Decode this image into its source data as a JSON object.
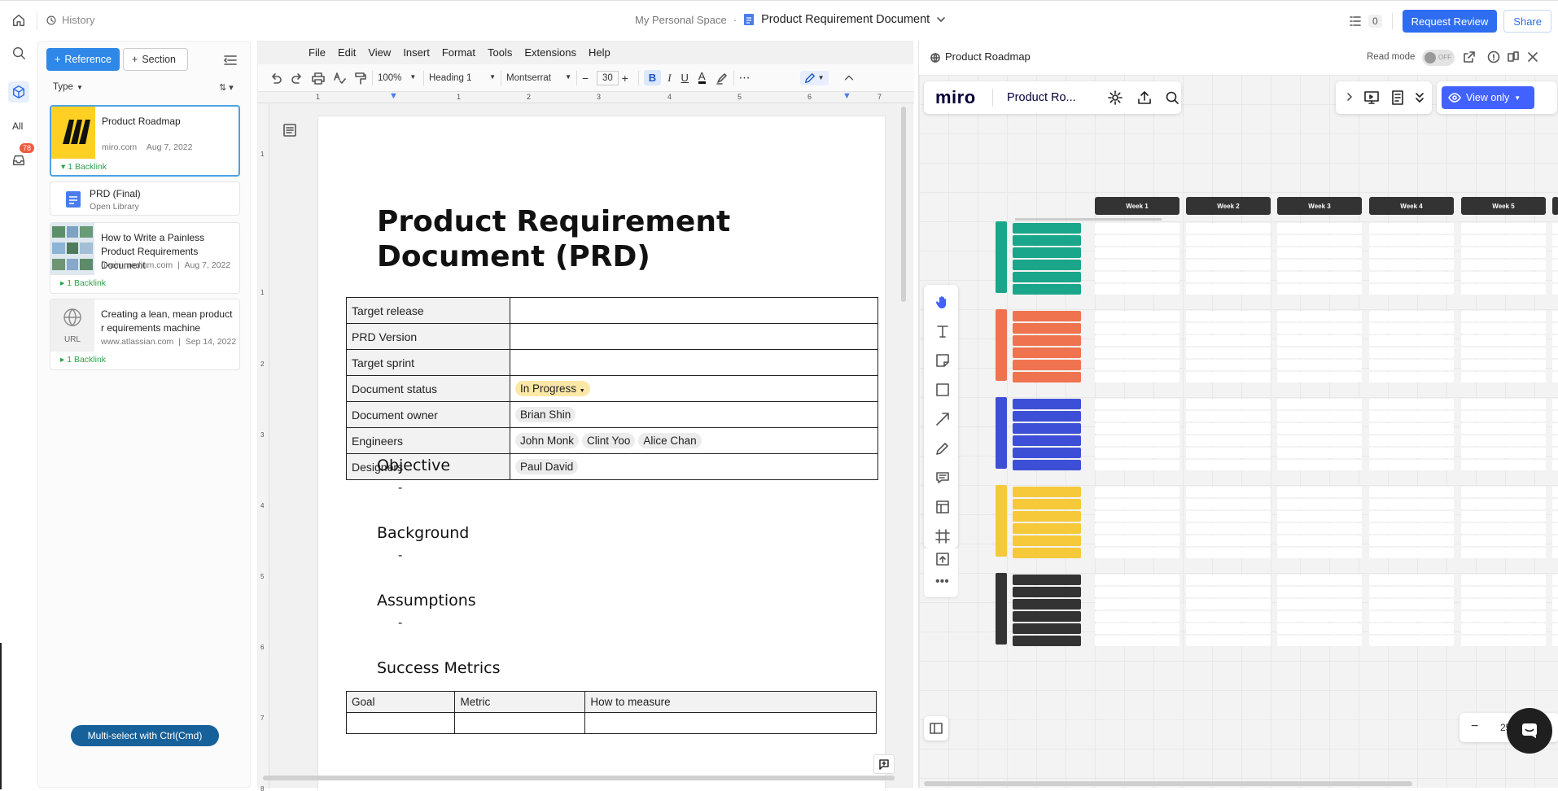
{
  "topbar": {
    "history_label": "History",
    "space": "My Personal Space",
    "doc_title": "Product Requirement Document",
    "task_count": "0",
    "request_review": "Request Review",
    "share": "Share"
  },
  "rail": {
    "all_label": "All",
    "inbox_badge": "78"
  },
  "library": {
    "reference_btn": "Reference",
    "section_btn": "Section",
    "type_filter": "Type",
    "items": [
      {
        "title": "Product Roadmap",
        "source": "miro.com",
        "date": "Aug 7, 2022",
        "backlink": "1 Backlink"
      },
      {
        "title": "PRD (Final)",
        "source": "Open Library"
      },
      {
        "title": "How to Write a Painless Product Requirements Document",
        "source": "uxpin.medium.com",
        "date": "Aug 7, 2022",
        "backlink": "1 Backlink"
      },
      {
        "title": "Creating a lean, mean product r equirements machine",
        "source": "www.atlassian.com",
        "date": "Sep 14, 2022",
        "backlink": "1 Backlink",
        "thumb_label": "URL"
      }
    ],
    "multiselect": "Multi-select with Ctrl(Cmd)"
  },
  "editor": {
    "menu": [
      "File",
      "Edit",
      "View",
      "Insert",
      "Format",
      "Tools",
      "Extensions",
      "Help"
    ],
    "zoom": "100%",
    "style": "Heading 1",
    "font": "Montserrat",
    "font_size": "30",
    "ruler_numbers": [
      "1",
      "1",
      "2",
      "3",
      "4",
      "5",
      "6",
      "7"
    ],
    "vruler_numbers": [
      "1",
      "1",
      "2",
      "3",
      "4",
      "5",
      "6",
      "7",
      "8"
    ],
    "title": "Product Requirement Document (PRD)",
    "meta_rows": [
      {
        "key": "Target release",
        "chips": []
      },
      {
        "key": "PRD Version",
        "chips": []
      },
      {
        "key": "Target sprint",
        "chips": []
      },
      {
        "key": "Document status",
        "chips": [
          "In Progress"
        ]
      },
      {
        "key": "Document owner",
        "chips": [
          "Brian Shin"
        ]
      },
      {
        "key": "Engineers",
        "chips": [
          "John Monk",
          "Clint Yoo",
          "Alice Chan"
        ]
      },
      {
        "key": "Designers",
        "chips": [
          "Paul David"
        ]
      }
    ],
    "sections": [
      "Objective",
      "Background",
      "Assumptions",
      "Success Metrics"
    ],
    "dash": "-",
    "goals_header": [
      "Goal",
      "Metric",
      "How to measure"
    ]
  },
  "right_panel": {
    "title": "Product Roadmap",
    "read_mode": "Read mode",
    "toggle": "OFF",
    "miro_logo": "miro",
    "board_title": "Product Ro...",
    "view_only": "View only",
    "zoom_value": "25",
    "weeks": [
      "Week 1",
      "Week 2",
      "Week 3",
      "Week 4",
      "Week 5"
    ],
    "groups": [
      {
        "color": "#1aa68a"
      },
      {
        "color": "#f0734f"
      },
      {
        "color": "#3d4fd6"
      },
      {
        "color": "#f5c93a"
      },
      {
        "color": "#333333"
      }
    ]
  }
}
